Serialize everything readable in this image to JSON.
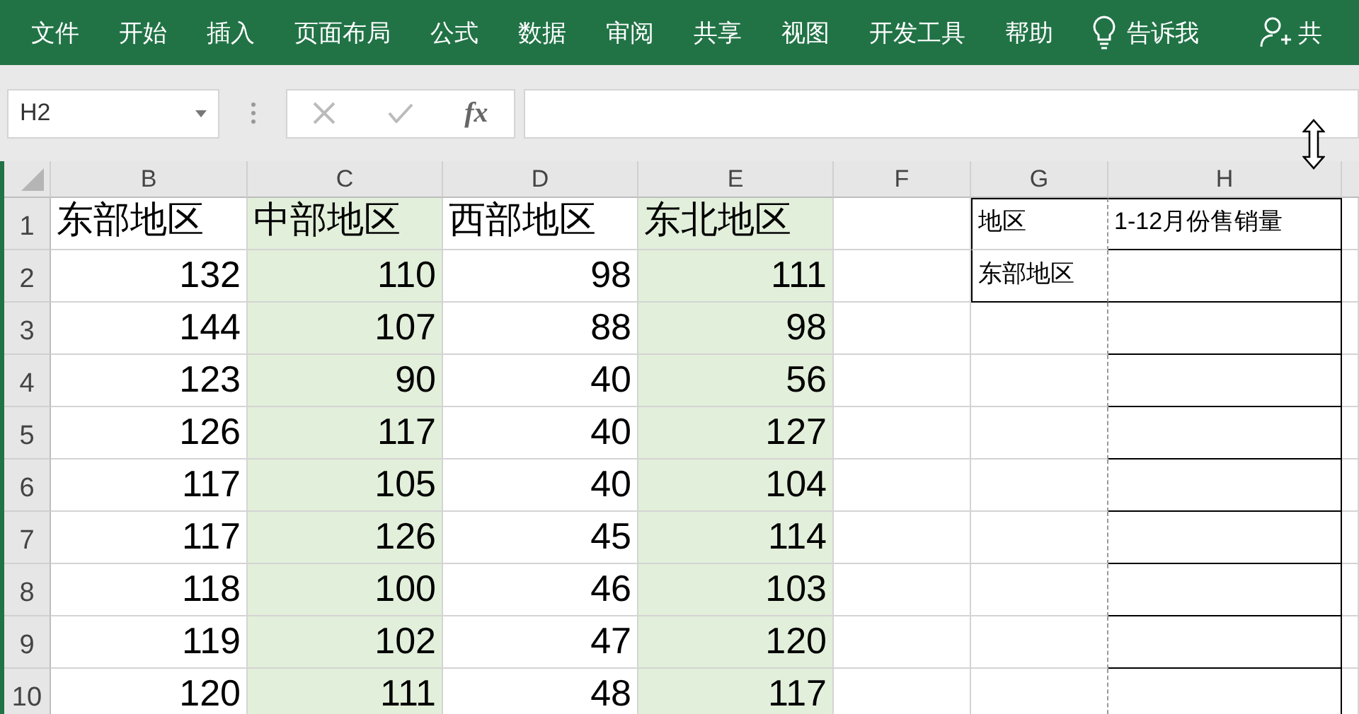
{
  "ribbon": {
    "tabs": [
      {
        "label": "文件"
      },
      {
        "label": "开始"
      },
      {
        "label": "插入"
      },
      {
        "label": "页面布局"
      },
      {
        "label": "公式"
      },
      {
        "label": "数据"
      },
      {
        "label": "审阅"
      },
      {
        "label": "共享"
      },
      {
        "label": "视图"
      },
      {
        "label": "开发工具"
      },
      {
        "label": "帮助"
      }
    ],
    "tell_me": "告诉我",
    "share": "共"
  },
  "formula_bar": {
    "name_box": "H2",
    "function_button": "fx"
  },
  "sheet": {
    "columns": [
      "B",
      "C",
      "D",
      "E",
      "F",
      "G",
      "H"
    ],
    "rows": [
      {
        "header": "1",
        "cells": [
          "东部地区",
          "中部地区",
          "西部地区",
          "东北地区",
          "",
          "地区",
          "1-12月份售销量"
        ]
      },
      {
        "header": "2",
        "cells": [
          "132",
          "110",
          "98",
          "111",
          "",
          "东部地区",
          ""
        ]
      },
      {
        "header": "3",
        "cells": [
          "144",
          "107",
          "88",
          "98",
          "",
          "",
          ""
        ]
      },
      {
        "header": "4",
        "cells": [
          "123",
          "90",
          "40",
          "56",
          "",
          "",
          ""
        ]
      },
      {
        "header": "5",
        "cells": [
          "126",
          "117",
          "40",
          "127",
          "",
          "",
          ""
        ]
      },
      {
        "header": "6",
        "cells": [
          "117",
          "105",
          "40",
          "104",
          "",
          "",
          ""
        ]
      },
      {
        "header": "7",
        "cells": [
          "117",
          "126",
          "45",
          "114",
          "",
          "",
          ""
        ]
      },
      {
        "header": "8",
        "cells": [
          "118",
          "100",
          "46",
          "103",
          "",
          "",
          ""
        ]
      },
      {
        "header": "9",
        "cells": [
          "119",
          "102",
          "47",
          "120",
          "",
          "",
          ""
        ]
      },
      {
        "header": "10",
        "cells": [
          "120",
          "111",
          "48",
          "117",
          "",
          "",
          ""
        ]
      }
    ]
  }
}
